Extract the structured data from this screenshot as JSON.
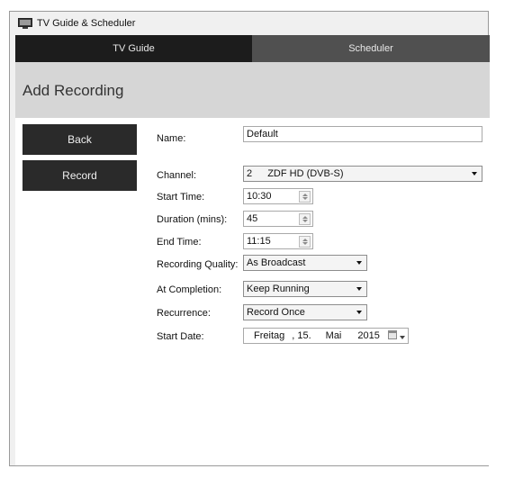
{
  "window": {
    "title": "TV Guide & Scheduler",
    "icon": "tv-icon"
  },
  "tabs": [
    {
      "label": "TV Guide",
      "active": true
    },
    {
      "label": "Scheduler",
      "active": false
    }
  ],
  "header": {
    "title": "Add Recording"
  },
  "buttons": {
    "back": "Back",
    "record": "Record"
  },
  "form": {
    "name": {
      "label": "Name:",
      "value": "Default"
    },
    "channel": {
      "label": "Channel:",
      "number": "2",
      "value": "ZDF HD  (DVB-S)"
    },
    "start_time": {
      "label": "Start Time:",
      "value": "10:30"
    },
    "duration": {
      "label": "Duration (mins):",
      "value": "45"
    },
    "end_time": {
      "label": "End Time:",
      "value": "11:15"
    },
    "quality": {
      "label": "Recording Quality:",
      "value": "As Broadcast"
    },
    "completion": {
      "label": "At Completion:",
      "value": "Keep Running"
    },
    "recurrence": {
      "label": "Recurrence:",
      "value": "Record Once"
    },
    "start_date": {
      "label": "Start Date:",
      "weekday": "Freitag",
      "day": ", 15.",
      "month": "Mai",
      "year": "2015"
    }
  },
  "colors": {
    "tab_active": "#1c1c1c",
    "tab_inactive": "#505050",
    "header_bg": "#d6d6d6",
    "button_bg": "#2a2a2a"
  }
}
